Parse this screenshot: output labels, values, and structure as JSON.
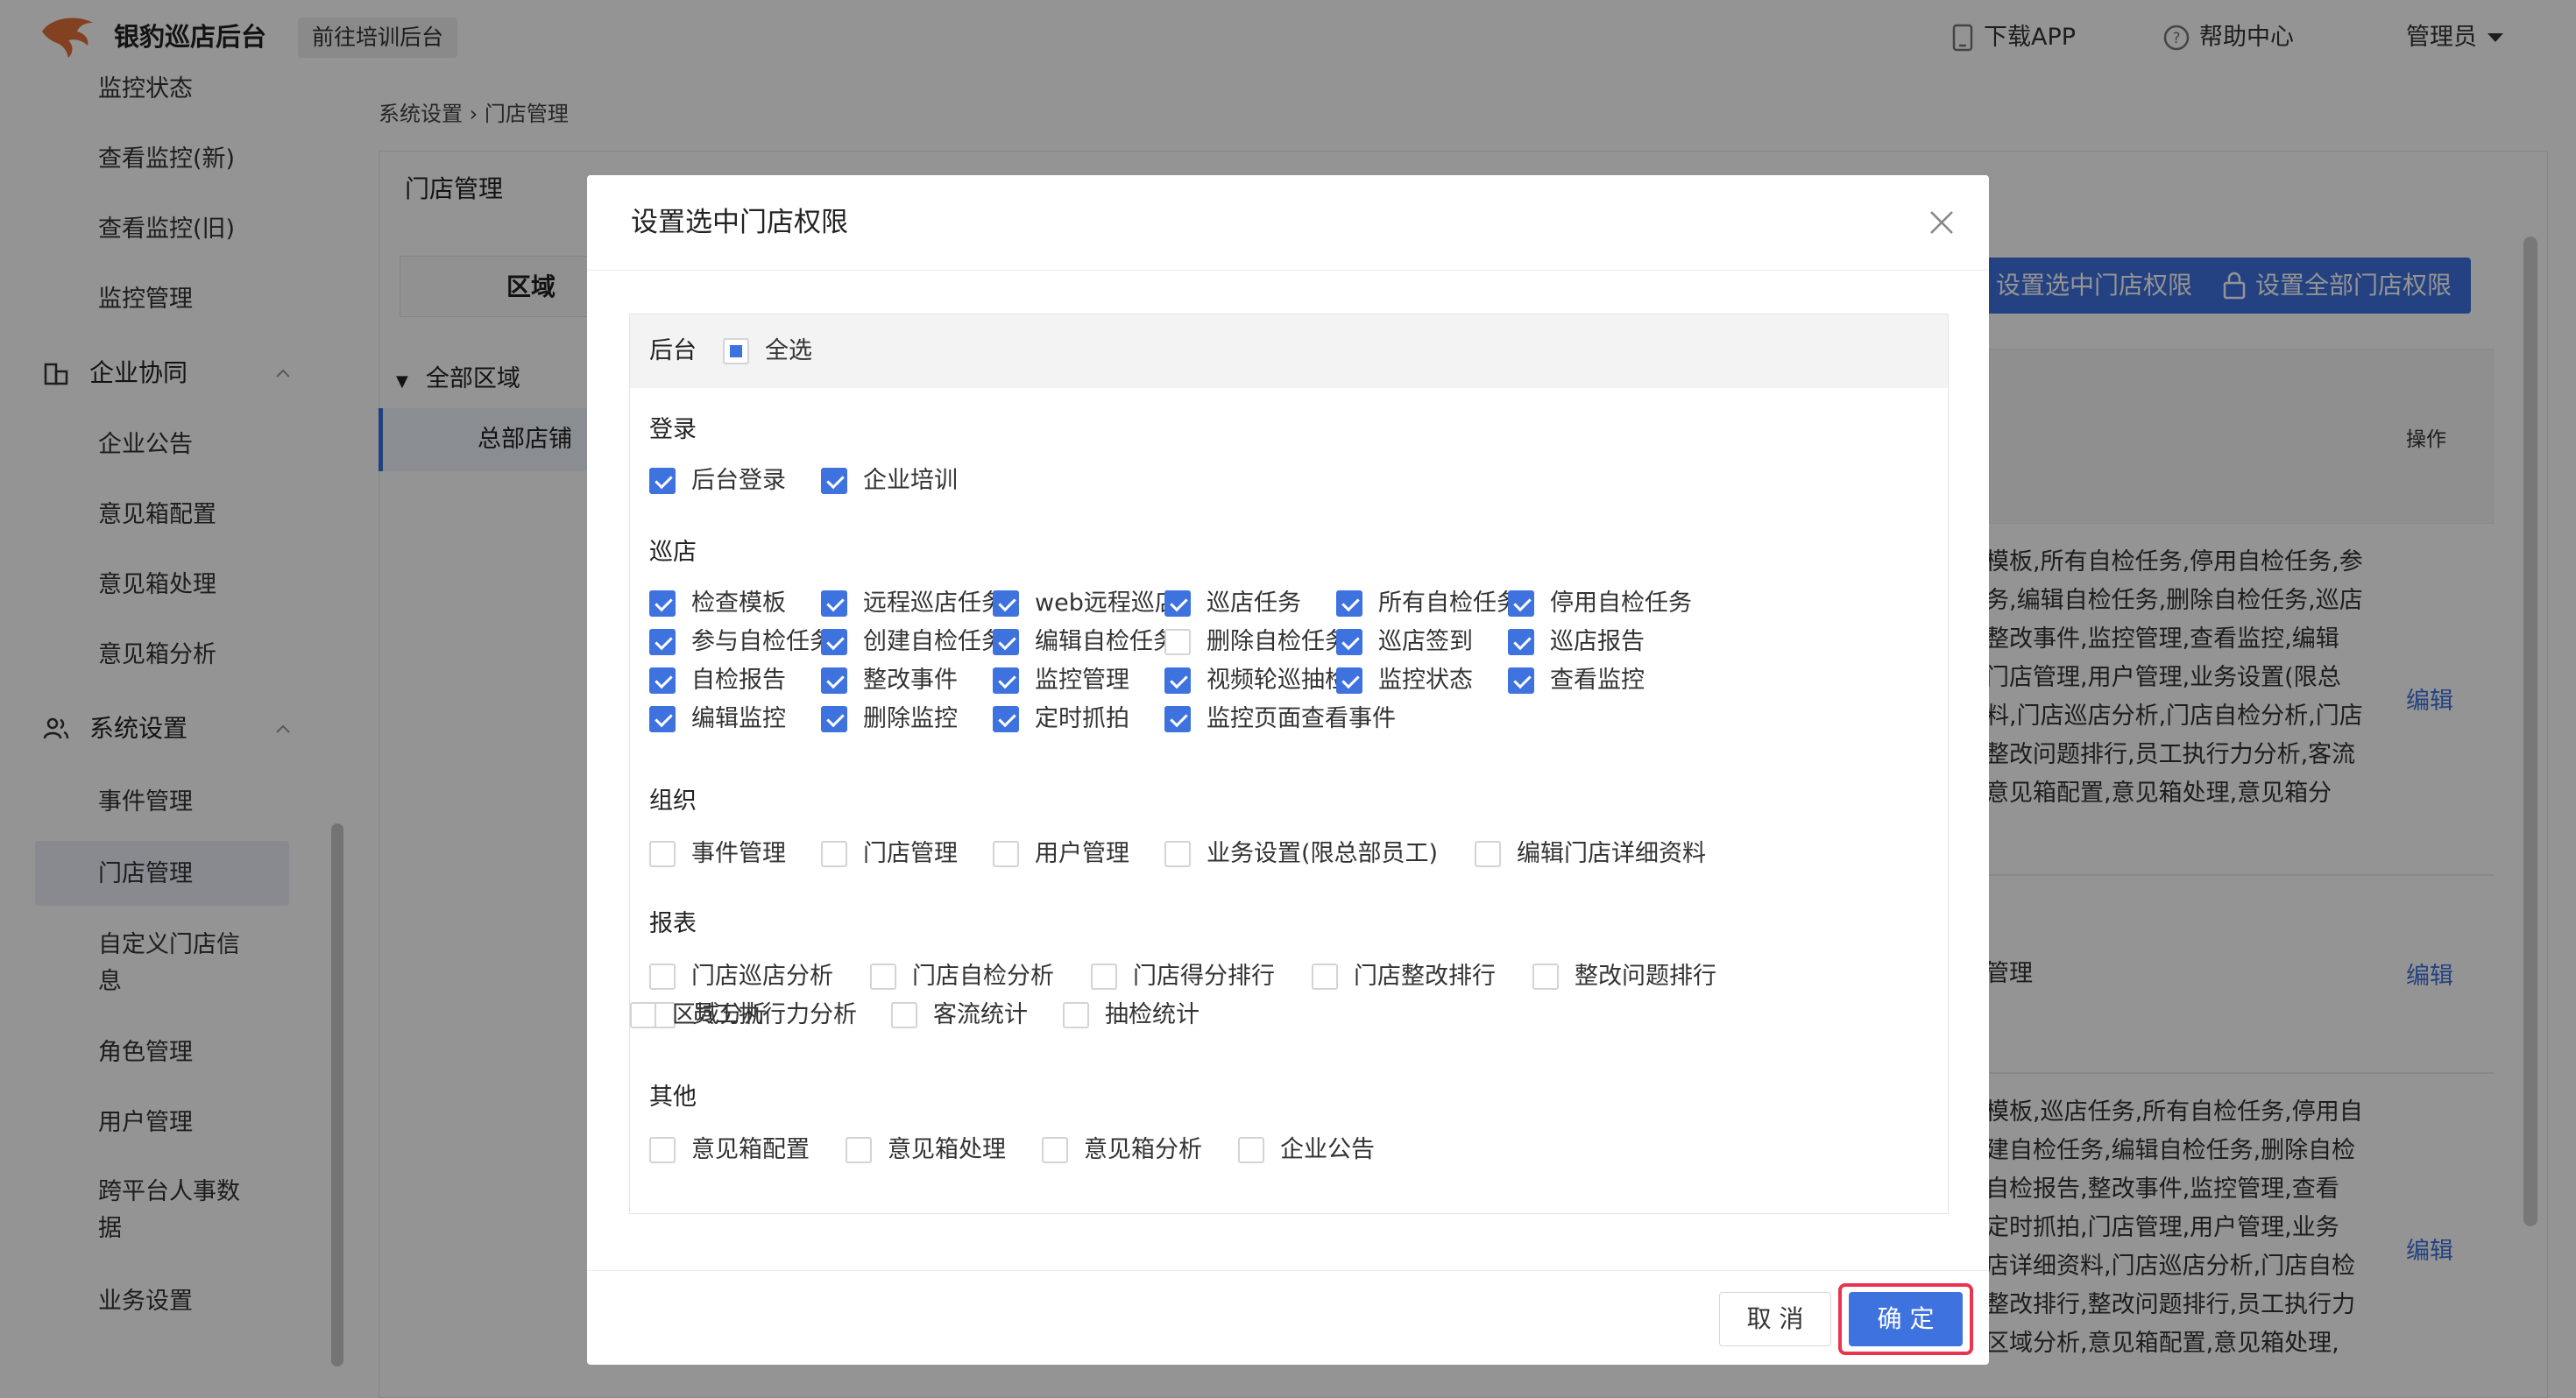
{
  "header": {
    "app_title": "银豹巡店后台",
    "goto_training": "前往培训后台",
    "download_app": "下载APP",
    "help_center": "帮助中心",
    "user": "管理员"
  },
  "sidebar": {
    "items_top": [
      "监控状态",
      "查看监控(新)",
      "查看监控(旧)",
      "监控管理"
    ],
    "group_collab": "企业协同",
    "collab_items": [
      "企业公告",
      "意见箱配置",
      "意见箱处理",
      "意见箱分析"
    ],
    "group_system": "系统设置",
    "system_items": [
      "事件管理",
      "门店管理",
      "自定义门店信\n息",
      "角色管理",
      "用户管理",
      "跨平台人事数\n据",
      "业务设置"
    ]
  },
  "main": {
    "breadcrumb": "系统设置 › 门店管理",
    "page_title": "门店管理",
    "region_tab": "区域",
    "tree_root": "全部区域",
    "tree_child": "总部店铺",
    "btn_set_selected": "设置选中门店权限",
    "btn_set_all": "设置全部门店权限",
    "col_operation": "操作",
    "rows": [
      {
        "lines": [
          "模板,所有自检任务,停用自检任务,参",
          "务,编辑自检任务,删除自检任务,巡店",
          "整改事件,监控管理,查看监控,编辑",
          "门店管理,用户管理,业务设置(限总",
          "料,门店巡店分析,门店自检分析,门店",
          "整改问题排行,员工执行力分析,客流",
          "意见箱配置,意见箱处理,意见箱分"
        ],
        "edit": "编辑"
      },
      {
        "lines": [
          "管理"
        ],
        "edit": "编辑"
      },
      {
        "lines": [
          "模板,巡店任务,所有自检任务,停用自",
          "建自检任务,编辑自检任务,删除自检",
          "自检报告,整改事件,监控管理,查看",
          "定时抓拍,门店管理,用户管理,业务",
          "店详细资料,门店巡店分析,门店自检",
          "整改排行,整改问题排行,员工执行力",
          "区域分析,意见箱配置,意见箱处理,"
        ],
        "edit": "编辑"
      }
    ]
  },
  "modal": {
    "title": "设置选中门店权限",
    "head_label": "后台",
    "select_all": "全选",
    "select_all_state": "partial",
    "sections": [
      {
        "name": "登录",
        "items": [
          {
            "label": "后台登录",
            "checked": true
          },
          {
            "label": "企业培训",
            "checked": true
          }
        ]
      },
      {
        "name": "巡店",
        "items": [
          {
            "label": "检查模板",
            "checked": true
          },
          {
            "label": "远程巡店任务",
            "checked": true
          },
          {
            "label": "web远程巡店",
            "checked": true
          },
          {
            "label": "巡店任务",
            "checked": true
          },
          {
            "label": "所有自检任务",
            "checked": true
          },
          {
            "label": "停用自检任务",
            "checked": true
          },
          {
            "label": "参与自检任务",
            "checked": true
          },
          {
            "label": "创建自检任务",
            "checked": true
          },
          {
            "label": "编辑自检任务",
            "checked": true
          },
          {
            "label": "删除自检任务",
            "checked": false
          },
          {
            "label": "巡店签到",
            "checked": true
          },
          {
            "label": "巡店报告",
            "checked": true
          },
          {
            "label": "自检报告",
            "checked": true
          },
          {
            "label": "整改事件",
            "checked": true
          },
          {
            "label": "监控管理",
            "checked": true
          },
          {
            "label": "视频轮巡抽检",
            "checked": true
          },
          {
            "label": "监控状态",
            "checked": true
          },
          {
            "label": "查看监控",
            "checked": true
          },
          {
            "label": "编辑监控",
            "checked": true
          },
          {
            "label": "删除监控",
            "checked": true
          },
          {
            "label": "定时抓拍",
            "checked": true
          },
          {
            "label": "监控页面查看事件",
            "checked": true
          }
        ]
      },
      {
        "name": "组织",
        "items": [
          {
            "label": "事件管理",
            "checked": false
          },
          {
            "label": "门店管理",
            "checked": false
          },
          {
            "label": "用户管理",
            "checked": false
          },
          {
            "label": "业务设置(限总部员工)",
            "checked": false
          },
          {
            "label": "编辑门店详细资料",
            "checked": false
          }
        ]
      },
      {
        "name": "报表",
        "items": [
          {
            "label": "门店巡店分析",
            "checked": false
          },
          {
            "label": "门店自检分析",
            "checked": false
          },
          {
            "label": "门店得分排行",
            "checked": false
          },
          {
            "label": "门店整改排行",
            "checked": false
          },
          {
            "label": "整改问题排行",
            "checked": false
          },
          {
            "label": "员工执行力分析",
            "checked": false
          },
          {
            "label": "客流统计",
            "checked": false
          },
          {
            "label": "抽检统计",
            "checked": false
          },
          {
            "label": "区域分析",
            "checked": false
          }
        ]
      },
      {
        "name": "其他",
        "items": [
          {
            "label": "意见箱配置",
            "checked": false
          },
          {
            "label": "意见箱处理",
            "checked": false
          },
          {
            "label": "意见箱分析",
            "checked": false
          },
          {
            "label": "企业公告",
            "checked": false
          }
        ]
      }
    ],
    "cancel": "取 消",
    "confirm": "确 定"
  },
  "colors": {
    "primary": "#3e72de",
    "highlight": "#e8344e"
  }
}
